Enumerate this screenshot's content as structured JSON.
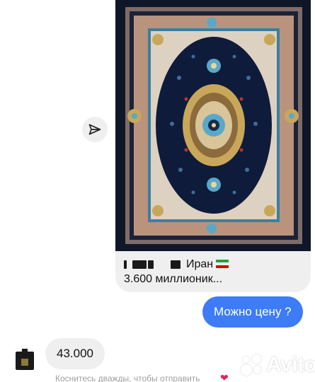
{
  "post": {
    "caption_line1_text": "Иран",
    "caption_line2": "3.600 миллионик...",
    "image_name": "persian-carpet-photo",
    "colors": {
      "field": "#0f1b33",
      "border": "#b58c73",
      "gold": "#c9a75a",
      "accent_blue": "#5aa8c8",
      "red": "#b8322e"
    }
  },
  "messages": {
    "outgoing_text": "Можно цену ?",
    "incoming_text": "43.000",
    "outgoing_color": "#3d7cf6"
  },
  "footer": {
    "hint": "Коснитесь дважды, чтобы отправить"
  },
  "watermark": {
    "brand": "Avito"
  },
  "icons": {
    "share": "paper-plane-icon",
    "heart": "heart-icon",
    "flag": "iran-flag-icon"
  }
}
